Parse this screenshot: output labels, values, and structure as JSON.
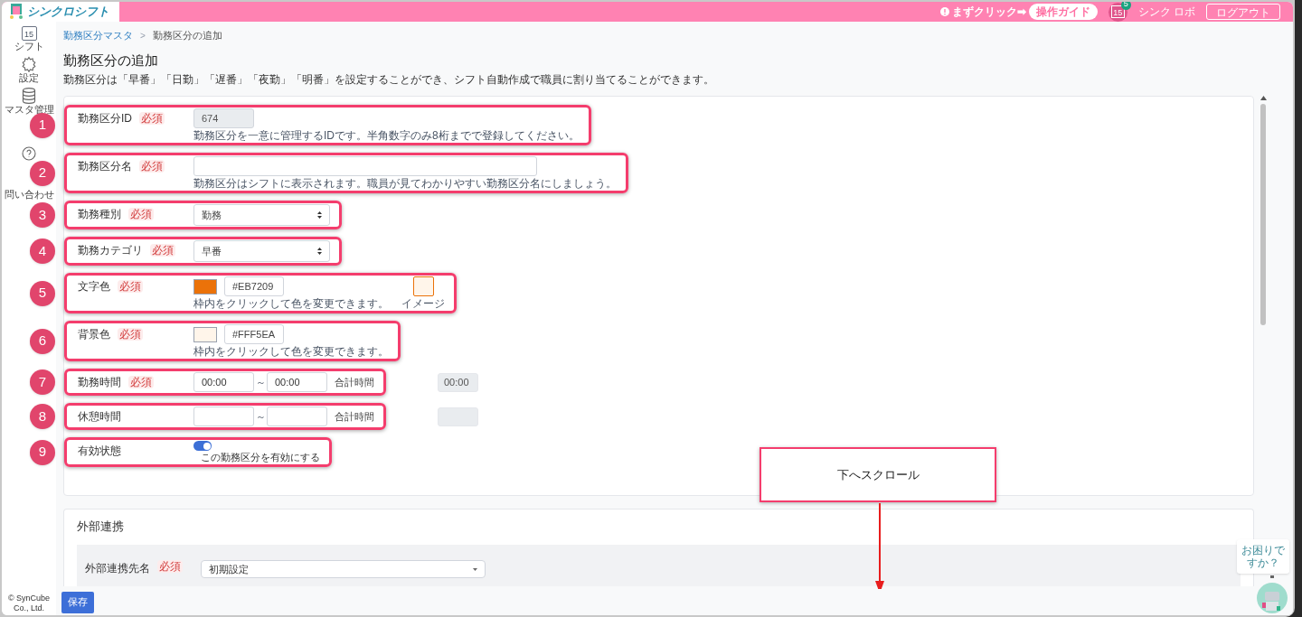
{
  "header": {
    "logo_text": "シンクロシフト",
    "prompt": "まずクリック➡",
    "guide_button": "操作ガイド",
    "calendar": {
      "day": "15",
      "badge": "5"
    },
    "user": "シンク ロボ",
    "logout": "ログアウト"
  },
  "sidebar": {
    "items": [
      {
        "kind": "calendar",
        "day": "15",
        "label": "シフト"
      },
      {
        "kind": "gear",
        "label": "設定"
      },
      {
        "kind": "database",
        "label": "マスタ管理"
      },
      {
        "kind": "help"
      },
      {
        "kind": "mail",
        "label": "問い合わせ"
      }
    ],
    "copyright": [
      "© SynCube",
      "Co., Ltd."
    ]
  },
  "breadcrumb": [
    {
      "label": "勤務区分マスタ",
      "link": true
    },
    {
      "label": "勤務区分の追加",
      "link": false
    }
  ],
  "breadcrumb_separator": ">",
  "title": "勤務区分の追加",
  "description": "勤務区分は「早番」「日勤」「遅番」「夜勤」「明番」を設定することができ、シフト自動作成で職員に割り当てることができます。",
  "fields": [
    {
      "kind": "text",
      "marker": "1",
      "label": "勤務区分ID",
      "required": "必須",
      "value": "674",
      "readonly": true,
      "wide": false,
      "help": "勤務区分を一意に管理するIDです。半角数字のみ8桁までで登録してください。"
    },
    {
      "kind": "text",
      "marker": "2",
      "label": "勤務区分名",
      "required": "必須",
      "readonly": false,
      "wide": true,
      "help": "勤務区分はシフトに表示されます。職員が見てわかりやすい勤務区分名にしましょう。"
    },
    {
      "kind": "select",
      "marker": "3",
      "label": "勤務種別",
      "required": "必須",
      "value": "勤務"
    },
    {
      "kind": "select",
      "marker": "4",
      "label": "勤務カテゴリ",
      "required": "必須",
      "value": "早番"
    },
    {
      "kind": "color",
      "marker": "5",
      "label": "文字色",
      "required": "必須",
      "color": "#eb7209",
      "value": "#EB7209",
      "help": "枠内をクリックして色を変更できます。",
      "preview": {
        "caption": "イメージ",
        "color": "#fff5ea"
      }
    },
    {
      "kind": "color",
      "marker": "6",
      "label": "背景色",
      "required": "必須",
      "color": "#fff5ea",
      "value": "#FFF5EA",
      "help": "枠内をクリックして色を変更できます。"
    },
    {
      "kind": "time",
      "marker": "7",
      "label": "勤務時間",
      "required": "必須",
      "from": "00:00",
      "to": "00:00",
      "sep": "～",
      "total_label": "合計時間",
      "total": "00:00"
    },
    {
      "kind": "time",
      "marker": "8",
      "label": "休憩時間",
      "sep": "～",
      "total_label": "合計時間"
    },
    {
      "kind": "toggle",
      "marker": "9",
      "label": "有効状態",
      "on": true,
      "caption": "この勤務区分を有効にする"
    }
  ],
  "external": {
    "title": "外部連携",
    "field_label": "外部連携先名",
    "required": "必須",
    "value": "初期設定"
  },
  "save_button": "保存",
  "callout": "下へスクロール",
  "help_bubble": [
    "お困りで",
    "すか？"
  ]
}
